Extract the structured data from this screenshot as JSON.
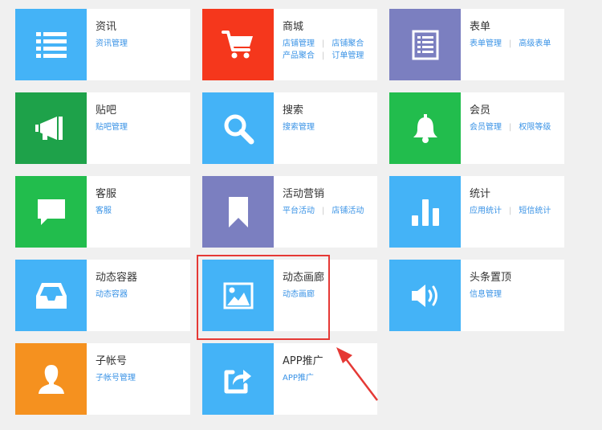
{
  "colors": {
    "blue": "#44b3f7",
    "red": "#f5371c",
    "purple": "#7b7fc0",
    "darkgreen": "#1ea24a",
    "green": "#22bd4d",
    "orange": "#f5911f",
    "link": "#3a93e6",
    "highlight": "#e53935"
  },
  "modules": [
    {
      "title": "资讯",
      "icon": "list-icon",
      "links": [
        [
          "资讯管理"
        ]
      ]
    },
    {
      "title": "商城",
      "icon": "shopping-cart-icon",
      "links": [
        [
          "店铺管理",
          "店铺聚合"
        ],
        [
          "产品聚合",
          "订单管理"
        ]
      ]
    },
    {
      "title": "表单",
      "icon": "form-document-icon",
      "links": [
        [
          "表单管理",
          "高级表单"
        ]
      ]
    },
    {
      "title": "贴吧",
      "icon": "megaphone-icon",
      "links": [
        [
          "贴吧管理"
        ]
      ]
    },
    {
      "title": "搜索",
      "icon": "magnifier-icon",
      "links": [
        [
          "搜索管理"
        ]
      ]
    },
    {
      "title": "会员",
      "icon": "bell-icon",
      "links": [
        [
          "会员管理",
          "权限等级"
        ]
      ]
    },
    {
      "title": "客服",
      "icon": "chat-bubble-icon",
      "links": [
        [
          "客服"
        ]
      ]
    },
    {
      "title": "活动营销",
      "icon": "bookmark-icon",
      "links": [
        [
          "平台活动",
          "店铺活动"
        ]
      ]
    },
    {
      "title": "统计",
      "icon": "bar-chart-icon",
      "links": [
        [
          "应用统计",
          "短信统计"
        ]
      ]
    },
    {
      "title": "动态容器",
      "icon": "inbox-tray-icon",
      "links": [
        [
          "动态容器"
        ]
      ]
    },
    {
      "title": "动态画廊",
      "icon": "picture-icon",
      "links": [
        [
          "动态画廊"
        ]
      ]
    },
    {
      "title": "头条置顶",
      "icon": "speaker-icon",
      "links": [
        [
          "信息管理"
        ]
      ]
    },
    {
      "title": "子帐号",
      "icon": "user-silhouette-icon",
      "links": [
        [
          "子帐号管理"
        ]
      ]
    },
    {
      "title": "APP推广",
      "icon": "share-arrow-icon",
      "links": [
        [
          "APP推广"
        ]
      ]
    }
  ]
}
